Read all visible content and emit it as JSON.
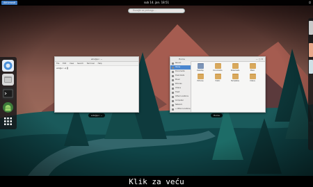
{
  "topbar": {
    "activities_label": "Aktivnosti",
    "clock": "sub 14. jan. 18:51",
    "tray_icons": [
      "power-icon"
    ]
  },
  "search": {
    "placeholder": "Kucajte za pretragu…"
  },
  "dash": {
    "items": [
      {
        "name": "browser",
        "color": "#4a90d9"
      },
      {
        "name": "files",
        "color": "#d8d8d8"
      },
      {
        "name": "terminal",
        "color": "#2b2b2b"
      },
      {
        "name": "android",
        "color": "#78c257"
      },
      {
        "name": "show-apps",
        "color": "#ffffff"
      }
    ]
  },
  "terminal_window": {
    "title": "sdx@pc: ~",
    "menu": [
      "File",
      "Edit",
      "View",
      "Search",
      "Terminal",
      "Help"
    ],
    "prompt": "sdx@pc:~$ ▌",
    "caption": "sdx@pc: ~"
  },
  "files_window": {
    "title": "Home",
    "caption": "Home",
    "sidebar": [
      "Recent",
      "Home",
      "Documents",
      "Downloads",
      "Music",
      "Pictures",
      "Videos",
      "Trash",
      "Other Locations",
      "Computer",
      "Network",
      "+ Other Locations",
      "Connect"
    ],
    "active_sidebar": 1,
    "folders": [
      "Desktop",
      "Documents",
      "Downloads",
      "Music",
      "Pictures",
      "Public",
      "Templates",
      "Videos"
    ]
  },
  "workspaces": {
    "count": 3,
    "colors": [
      "#c9c9c9",
      "#e8a88a",
      "#cfe0e6"
    ]
  },
  "tooltip": {
    "text": "Klik za veću"
  },
  "colors": {
    "sky_top": "#2e1a18",
    "sky_mid": "#9a6658",
    "mountain_red": "#a15a4f",
    "forest_dark": "#0f3f42",
    "forest_teal": "#1d6c67"
  }
}
